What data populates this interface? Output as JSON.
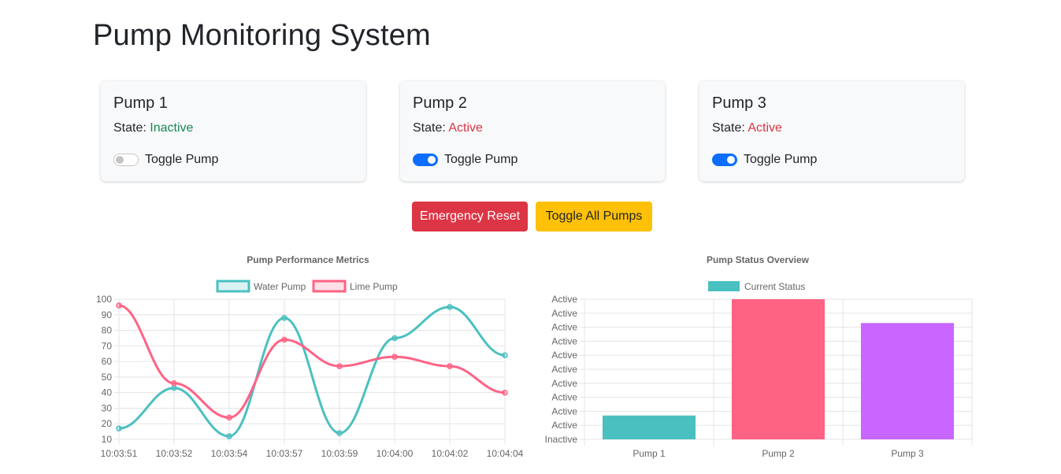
{
  "page": {
    "title": "Pump Monitoring System"
  },
  "pumps": [
    {
      "name": "Pump 1",
      "state_label": "State:",
      "state": "Inactive",
      "on": false,
      "toggle_label": "Toggle Pump"
    },
    {
      "name": "Pump 2",
      "state_label": "State:",
      "state": "Active",
      "on": true,
      "toggle_label": "Toggle Pump"
    },
    {
      "name": "Pump 3",
      "state_label": "State:",
      "state": "Active",
      "on": true,
      "toggle_label": "Toggle Pump"
    }
  ],
  "actions": {
    "emergency_reset": "Emergency Reset",
    "toggle_all": "Toggle All Pumps"
  },
  "colors": {
    "teal": "#4bc0c0",
    "pink": "#ff6384",
    "purple": "#c966ff",
    "danger": "#dc3545",
    "warning": "#ffc107",
    "primary": "#0d6efd",
    "success": "#198754"
  },
  "chart_data": [
    {
      "type": "line",
      "title": "Pump Performance Metrics",
      "legend_position": "top",
      "grid": true,
      "x": [
        "10:03:51",
        "10:03:52",
        "10:03:54",
        "10:03:57",
        "10:03:59",
        "10:04:00",
        "10:04:02",
        "10:04:04"
      ],
      "yticks": [
        "100",
        "90",
        "80",
        "70",
        "60",
        "50",
        "40",
        "30",
        "20",
        "10"
      ],
      "ylim": [
        10,
        100
      ],
      "series": [
        {
          "name": "Water Pump",
          "color": "#4bc0c0",
          "values": [
            17,
            43,
            12,
            88,
            14,
            75,
            95,
            64
          ]
        },
        {
          "name": "Lime Pump",
          "color": "#ff6384",
          "values": [
            96,
            46,
            24,
            74,
            57,
            63,
            57,
            40
          ]
        }
      ]
    },
    {
      "type": "bar",
      "title": "Pump Status Overview",
      "legend_position": "top",
      "grid": true,
      "categories": [
        "Pump 1",
        "Pump 2",
        "Pump 3"
      ],
      "ylim": [
        0,
        1
      ],
      "yticks": [
        "Active",
        "Active",
        "Active",
        "Active",
        "Active",
        "Active",
        "Active",
        "Active",
        "Active",
        "Active",
        "Inactive"
      ],
      "series": [
        {
          "name": "Current Status",
          "color": "#4bc0c0",
          "values": [
            0.17,
            1.0,
            0.83
          ],
          "colors": [
            "#4bc0c0",
            "#ff6384",
            "#c966ff"
          ]
        }
      ]
    }
  ]
}
